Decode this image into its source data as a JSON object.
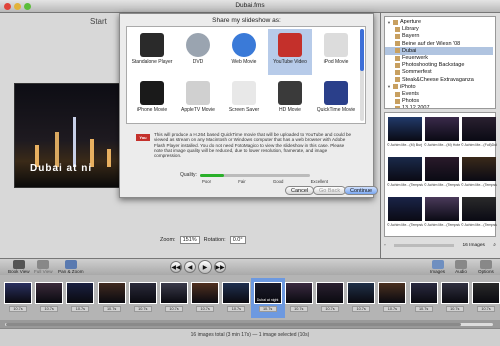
{
  "window": {
    "title": "Dubai.fms"
  },
  "stage": {
    "start_label": "Start",
    "slide_caption": "Dubai at ni",
    "zoom_label": "Zoom:",
    "zoom_value": "151%",
    "rotation_label": "Rotation:",
    "rotation_value": "0.0°"
  },
  "sheet": {
    "title": "Share my slideshow as:",
    "options": [
      {
        "label": "Standalone Player",
        "icon": "puzzle-icon",
        "color": "#2a2a2a"
      },
      {
        "label": "DVD",
        "icon": "dvd-disc-icon",
        "color": "#9aa4b0"
      },
      {
        "label": "Web Movie",
        "icon": "safari-compass-icon",
        "color": "#3a7ad8"
      },
      {
        "label": "YouTube Video",
        "icon": "youtube-icon",
        "color": "#c4302b",
        "selected": true
      },
      {
        "label": "iPod Movie",
        "icon": "ipod-icon",
        "color": "#dcdcdc"
      },
      {
        "label": "iPhone Movie",
        "icon": "iphone-icon",
        "color": "#1a1a1a"
      },
      {
        "label": "AppleTV Movie",
        "icon": "appletv-icon",
        "color": "#d0d0d0"
      },
      {
        "label": "Screen Saver",
        "icon": "screen-saver-icon",
        "color": "#e8e8e8"
      },
      {
        "label": "HD Movie",
        "icon": "hd-icon",
        "color": "#3a3a3a"
      },
      {
        "label": "QuickTime Movie",
        "icon": "quicktime-icon",
        "color": "#2a3f8a"
      }
    ],
    "description": "This will produce a H.264 based QuickTime movie that will be uploaded to YouTube and could be viewed as stream on any Macintosh or Windows computer that has a web browser with Adobe Flash Player installed. You do not need FotoMagico to view the slideshow in this case. Please note that image quality will be reduced, due to lower resolution, framerate, and image compression.",
    "quality_label": "Quality:",
    "quality_level": 0.22,
    "quality_ticks": [
      "Poor",
      "Fair",
      "Good",
      "Excellent"
    ],
    "buttons": {
      "cancel": "Cancel",
      "back": "Go Back",
      "continue": "Continue"
    }
  },
  "sidebar": {
    "sources": [
      {
        "label": "Aperture",
        "level": 0,
        "expanded": true
      },
      {
        "label": "Library",
        "level": 1
      },
      {
        "label": "Bayern",
        "level": 1
      },
      {
        "label": "Beine auf der Wiesn '08",
        "level": 1
      },
      {
        "label": "Dubai",
        "level": 1,
        "selected": true
      },
      {
        "label": "Feuerwerk",
        "level": 1
      },
      {
        "label": "Photoshooting Backstage",
        "level": 1
      },
      {
        "label": "Sommerfest",
        "level": 1
      },
      {
        "label": "Steak&Cheese Extravaganza",
        "level": 1
      },
      {
        "label": "iPhoto",
        "level": 0,
        "expanded": true
      },
      {
        "label": "Events",
        "level": 1
      },
      {
        "label": "Photos",
        "level": 1
      },
      {
        "label": "13.12.2007",
        "level": 1
      }
    ],
    "thumbs": [
      {
        "caption": "© Achim Me...(M) Burj Al...",
        "color": "#223a6a"
      },
      {
        "caption": "© Achim Me...(M) Hotel",
        "color": "#3a2a4a"
      },
      {
        "caption": "© Achim Me...(Full)Dubai",
        "color": "#2a2030"
      },
      {
        "caption": "© Achim Me...(Tempstable)",
        "color": "#1a2a4a"
      },
      {
        "caption": "© Achim Me...(Tempstable)",
        "color": "#2a1a2a"
      },
      {
        "caption": "© Achim Me...(Tempstable)",
        "color": "#3a2a1a"
      },
      {
        "caption": "© Achim Me...(Tempstable)",
        "color": "#1a2448"
      },
      {
        "caption": "© Achim Me...(Tempstable)",
        "color": "#4a3a5a"
      },
      {
        "caption": "© Achim Me...(Tempstable)",
        "color": "#2a2a2a"
      }
    ],
    "image_count": "16 Images"
  },
  "toolbar": {
    "book_view": "Book View",
    "full_view": "Full View",
    "pan_zoom": "Pan & Zoom",
    "images": "Images",
    "audio": "Audio",
    "options": "Options"
  },
  "filmstrip": {
    "frames": [
      {
        "duration": "10.7s",
        "color": "#2a3060"
      },
      {
        "duration": "10.7s",
        "color": "#3a2a3a"
      },
      {
        "duration": "10.7s",
        "color": "#1a2040"
      },
      {
        "duration": "10.7s",
        "color": "#402a20"
      },
      {
        "duration": "10.7s",
        "color": "#2a2a3a"
      },
      {
        "duration": "10.7s",
        "color": "#3a3a4a"
      },
      {
        "duration": "10.7s",
        "color": "#503020"
      },
      {
        "duration": "10.7s",
        "color": "#203050"
      },
      {
        "duration": "10.7s",
        "color": "#1a1a2a",
        "selected": true,
        "caption": "Dubai at night"
      },
      {
        "duration": "10.7s",
        "color": "#3a2a40"
      },
      {
        "duration": "10.7s",
        "color": "#2a2030"
      },
      {
        "duration": "10.7s",
        "color": "#203048"
      },
      {
        "duration": "10.7s",
        "color": "#4a3020"
      },
      {
        "duration": "10.7s",
        "color": "#2a2a40"
      },
      {
        "duration": "10.7s",
        "color": "#303040"
      },
      {
        "duration": "10.7s",
        "color": "#2a2a2a"
      }
    ]
  },
  "status": {
    "text": "16 images total (3 min 17s) — 1 image selected (10s)"
  }
}
